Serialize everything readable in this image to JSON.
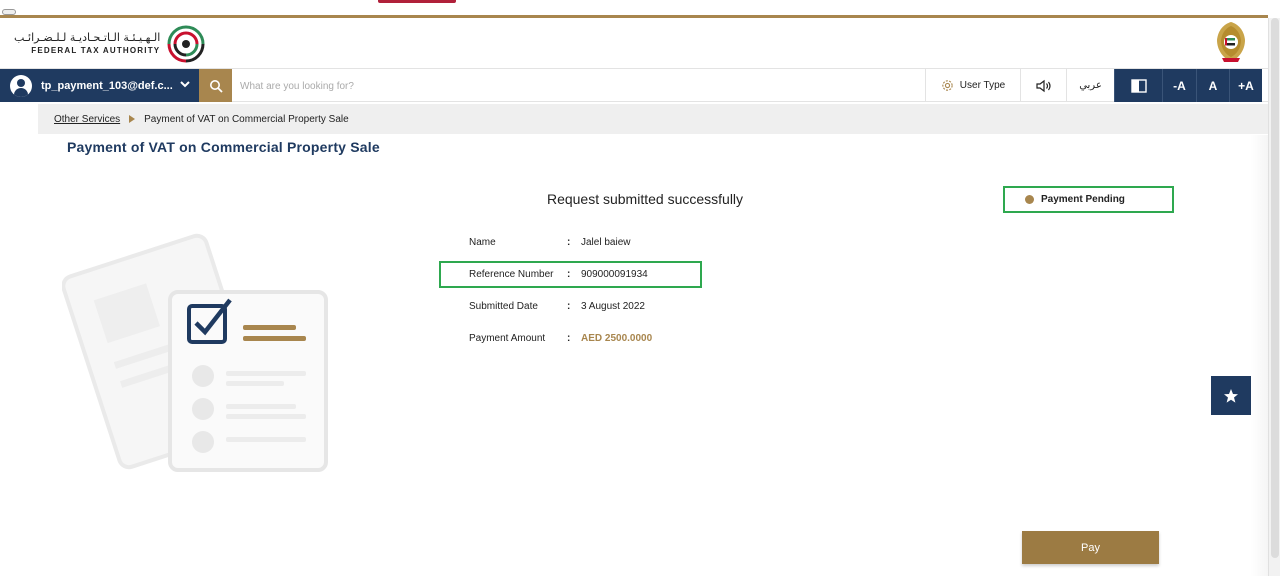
{
  "header": {
    "logo_ar": "الـهـيـئـة الـاتـحـاديـة لـلـضـرائـب",
    "logo_en": "FEDERAL TAX AUTHORITY"
  },
  "navbar": {
    "user_email": "tp_payment_103@def.c...",
    "search_placeholder": "What are you looking for?",
    "user_type_label": "User Type",
    "language_label": "عربي",
    "font_decrease": "-A",
    "font_normal": "A",
    "font_increase": "+A"
  },
  "breadcrumb": {
    "parent": "Other Services",
    "current": "Payment of VAT on Commercial Property Sale"
  },
  "page": {
    "title": "Payment of VAT on Commercial Property Sale",
    "success_message": "Request submitted successfully",
    "status": "Payment Pending",
    "pay_label": "Pay"
  },
  "details": [
    {
      "label": "Name",
      "value": "Jalel baiew"
    },
    {
      "label": "Reference Number",
      "value": "909000091934"
    },
    {
      "label": "Submitted Date",
      "value": "3 August 2022"
    },
    {
      "label": "Payment Amount",
      "value": "AED 2500.0000"
    }
  ],
  "colors": {
    "brand_navy": "#1f3a60",
    "brand_gold": "#a8864e",
    "highlight_green": "#2ea84f"
  },
  "icons": {
    "search": "search-icon",
    "user": "user-icon",
    "chevron": "chevron-down-icon",
    "gear": "gear-icon",
    "speaker": "speaker-icon",
    "contrast": "contrast-icon",
    "star": "star-icon"
  }
}
